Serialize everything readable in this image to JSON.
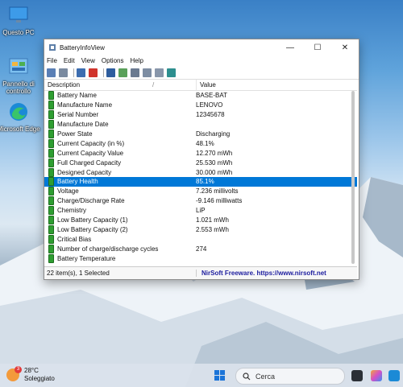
{
  "desktop": {
    "icons": [
      {
        "label": "Questo PC",
        "icon": "monitor-icon"
      },
      {
        "label": "Pannello di controllo",
        "icon": "control-panel-icon"
      },
      {
        "label": "Microsoft Edge",
        "icon": "edge-icon"
      }
    ]
  },
  "window": {
    "title": "BatteryInfoView",
    "controls": {
      "minimize": "—",
      "maximize": "☐",
      "close": "✕"
    },
    "menu": [
      "File",
      "Edit",
      "View",
      "Options",
      "Help"
    ],
    "columns": {
      "description": "Description",
      "value": "Value",
      "sort_indicator": "/"
    },
    "rows": [
      {
        "description": "Battery Name",
        "value": "BASE-BAT"
      },
      {
        "description": "Manufacture Name",
        "value": "LENOVO"
      },
      {
        "description": "Serial Number",
        "value": "12345678"
      },
      {
        "description": "Manufacture Date",
        "value": ""
      },
      {
        "description": "Power State",
        "value": "Discharging"
      },
      {
        "description": "Current Capacity (in %)",
        "value": "48.1%"
      },
      {
        "description": "Current Capacity Value",
        "value": "12.270 mWh"
      },
      {
        "description": "Full Charged Capacity",
        "value": "25.530 mWh"
      },
      {
        "description": "Designed Capacity",
        "value": "30.000 mWh"
      },
      {
        "description": "Battery Health",
        "value": "85.1%",
        "selected": true
      },
      {
        "description": "Voltage",
        "value": "7.236 millivolts"
      },
      {
        "description": "Charge/Discharge Rate",
        "value": "-9.146 milliwatts"
      },
      {
        "description": "Chemistry",
        "value": "LiP"
      },
      {
        "description": "Low Battery Capacity (1)",
        "value": "1.021 mWh"
      },
      {
        "description": "Low Battery Capacity (2)",
        "value": "2.553 mWh"
      },
      {
        "description": "Critical Bias",
        "value": ""
      },
      {
        "description": "Number of charge/discharge cycles",
        "value": "274"
      },
      {
        "description": "Battery Temperature",
        "value": ""
      }
    ],
    "status": {
      "items": "22 item(s), 1 Selected",
      "credit": "NirSoft Freeware. https://www.nirsoft.net"
    }
  },
  "taskbar": {
    "weather": {
      "badge": "3",
      "temp": "28°C",
      "condition": "Soleggiato"
    },
    "search_placeholder": "Cerca"
  },
  "colors": {
    "selection": "#0078d7",
    "battery": "#2e9e31",
    "credit_link": "#1b1b9e"
  }
}
